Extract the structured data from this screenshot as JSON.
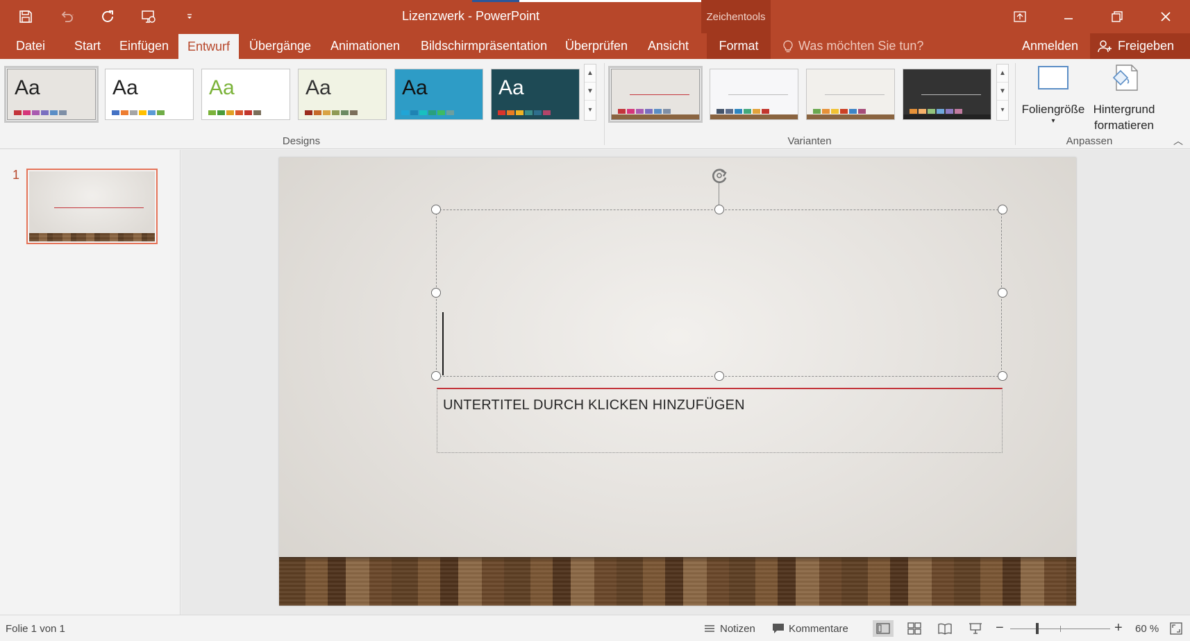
{
  "window": {
    "title": "Lizenzwerk - PowerPoint",
    "contextual_group": "Zeichentools"
  },
  "tabs": [
    {
      "label": "Datei",
      "active": false
    },
    {
      "label": "Start",
      "active": false
    },
    {
      "label": "Einfügen",
      "active": false
    },
    {
      "label": "Entwurf",
      "active": true
    },
    {
      "label": "Übergänge",
      "active": false
    },
    {
      "label": "Animationen",
      "active": false
    },
    {
      "label": "Bildschirmpräsentation",
      "active": false
    },
    {
      "label": "Überprüfen",
      "active": false
    },
    {
      "label": "Ansicht",
      "active": false
    },
    {
      "label": "Format",
      "active": false
    }
  ],
  "tell_me": {
    "placeholder": "Was möchten Sie tun?"
  },
  "account": {
    "signin": "Anmelden",
    "share": "Freigeben"
  },
  "ribbon": {
    "designs": {
      "label": "Designs",
      "themes": [
        {
          "aa": "Aa",
          "bg": "#e7e4e0",
          "fg": "#222222",
          "swatches": [
            "#c3343a",
            "#d6367a",
            "#a95ab0",
            "#7a6fc0",
            "#5b8ec6",
            "#7f8fa6"
          ]
        },
        {
          "aa": "Aa",
          "bg": "#ffffff",
          "fg": "#222222",
          "swatches": [
            "#4472c4",
            "#ed7d31",
            "#a5a5a5",
            "#ffc000",
            "#5b9bd5",
            "#70ad47"
          ]
        },
        {
          "aa": "Aa",
          "bg": "#ffffff",
          "fg": "#7bb33a",
          "swatches": [
            "#7bb33a",
            "#4a9b3a",
            "#e0a125",
            "#d9562f",
            "#c2362e",
            "#7a6e5a"
          ]
        },
        {
          "aa": "Aa",
          "bg": "#f1f3e4",
          "fg": "#333333",
          "swatches": [
            "#9a2b1e",
            "#c66a2a",
            "#d9a445",
            "#8f9a55",
            "#6c8a62",
            "#7b6f5a"
          ]
        },
        {
          "aa": "Aa",
          "bg": "#2e9cc6",
          "fg": "#111111",
          "swatches": [
            "#21a5d6",
            "#1e83b3",
            "#18c0c0",
            "#29a07e",
            "#3dbb63",
            "#6c9f9f"
          ]
        },
        {
          "aa": "Aa",
          "bg": "#1e4a55",
          "fg": "#ffffff",
          "swatches": [
            "#d9342b",
            "#e97b23",
            "#f0b323",
            "#3a8d8a",
            "#2e6e8c",
            "#b2456a"
          ]
        }
      ]
    },
    "variants": {
      "label": "Varianten",
      "items": [
        {
          "bg": "#e7e4e0",
          "swatches": [
            "#c3343a",
            "#d6367a",
            "#a95ab0",
            "#7a6fc0",
            "#5b8ec6",
            "#7f8fa6"
          ]
        },
        {
          "bg": "#f7f7f9",
          "swatches": [
            "#44546a",
            "#5b6c8a",
            "#2e86c1",
            "#44a97c",
            "#e2a23a",
            "#c2362e"
          ]
        },
        {
          "bg": "#f2f0ec",
          "swatches": [
            "#6aa84f",
            "#e69138",
            "#f1c232",
            "#cc4125",
            "#3d85c6",
            "#a64d79"
          ]
        },
        {
          "bg": "#333333",
          "swatches": [
            "#e69138",
            "#f6b26b",
            "#93c47d",
            "#6fa8dc",
            "#8e7cc3",
            "#c27ba0"
          ]
        }
      ]
    },
    "customize": {
      "label": "Anpassen",
      "slide_size": "Foliengröße",
      "format_bg_line1": "Hintergrund",
      "format_bg_line2": "formatieren"
    }
  },
  "thumbnails": [
    {
      "number": "1"
    }
  ],
  "slide": {
    "subtitle_placeholder": "UNTERTITEL DURCH KLICKEN HINZUFÜGEN"
  },
  "status": {
    "slide_info": "Folie 1 von 1",
    "notes": "Notizen",
    "comments": "Kommentare",
    "zoom_percent": 60,
    "zoom_label": "60 %"
  },
  "colors": {
    "accent": "#b7472a",
    "accent_dark": "#a1381e",
    "title_line": "#c3343a"
  }
}
